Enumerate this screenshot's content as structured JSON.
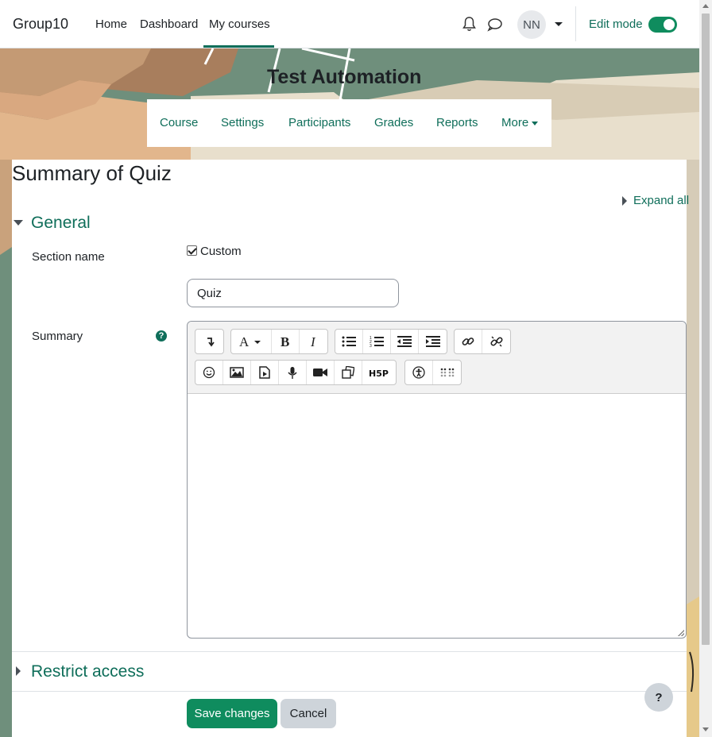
{
  "navbar": {
    "brand": "Group10",
    "links": [
      "Home",
      "Dashboard",
      "My courses"
    ],
    "active_link": "My courses",
    "avatar_initials": "NN",
    "edit_mode_label": "Edit mode",
    "edit_mode_on": true
  },
  "course": {
    "title": "Test Automation"
  },
  "secondary_nav": {
    "items": [
      "Course",
      "Settings",
      "Participants",
      "Grades",
      "Reports",
      "More"
    ]
  },
  "page": {
    "title": "Summary of Quiz",
    "expand_all": "Expand all"
  },
  "general": {
    "heading": "General",
    "section_name_label": "Section name",
    "custom_checkbox_label": "Custom",
    "custom_checked": true,
    "section_name_value": "Quiz",
    "summary_label": "Summary",
    "help_glyph": "?"
  },
  "editor": {
    "toolbar_row1": [
      [
        "collapse-icon"
      ],
      [
        "font-style-icon",
        "bold-icon",
        "italic-icon"
      ],
      [
        "unordered-list-icon",
        "ordered-list-icon",
        "outdent-icon",
        "indent-icon"
      ],
      [
        "link-icon",
        "unlink-icon"
      ]
    ],
    "toolbar_row2": [
      [
        "emoji-icon",
        "image-icon",
        "media-icon",
        "record-audio-icon",
        "record-video-icon",
        "manage-files-icon",
        "h5p-icon"
      ],
      [
        "accessibility-checker-icon",
        "screenreader-helper-icon"
      ]
    ],
    "content": ""
  },
  "restrict_access": {
    "heading": "Restrict access"
  },
  "buttons": {
    "save": "Save changes",
    "cancel": "Cancel"
  },
  "help_button": "?",
  "colors": {
    "accent": "#0f6e5a",
    "primary_button": "#0f8c5e",
    "secondary_button": "#ced4da"
  }
}
